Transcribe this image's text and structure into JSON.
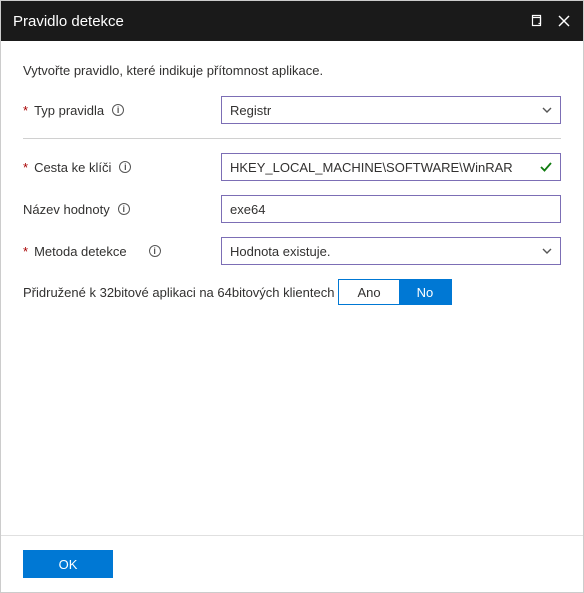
{
  "header": {
    "title": "Pravidlo detekce"
  },
  "instruction": "Vytvořte pravidlo, které indikuje přítomnost aplikace.",
  "fields": {
    "ruleType": {
      "label": "Typ pravidla",
      "value": "Registr"
    },
    "keyPath": {
      "label": "Cesta ke klíči",
      "value": "HKEY_LOCAL_MACHINE\\SOFTWARE\\WinRAR"
    },
    "valueName": {
      "label": "Název hodnoty",
      "value": "exe64"
    },
    "method": {
      "label": "Metoda detekce",
      "value": "Hodnota existuje."
    }
  },
  "toggle": {
    "label": "Přidružené k 32bitové aplikaci na 64bitových klientech",
    "yes": "Ano",
    "no": "No",
    "selected": "no"
  },
  "footer": {
    "ok": "OK"
  }
}
